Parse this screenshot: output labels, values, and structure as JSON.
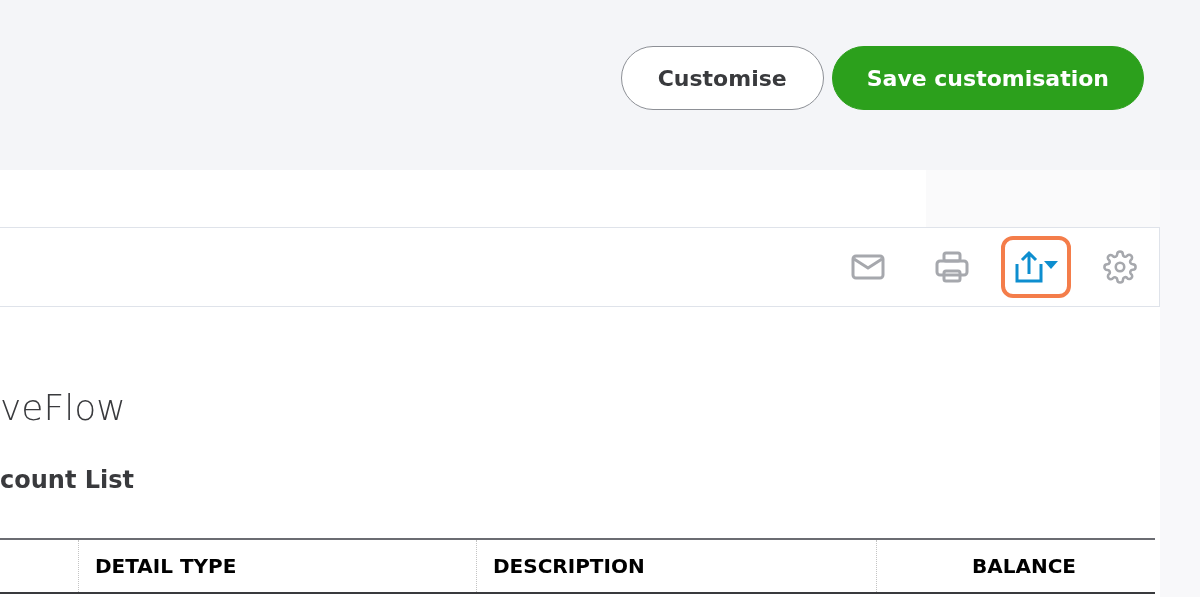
{
  "header": {
    "buttons": [
      {
        "label": "Customise",
        "kind": "secondary"
      },
      {
        "label": "Save customisation",
        "kind": "primary"
      }
    ]
  },
  "report_toolbar": {
    "icons": [
      {
        "kind": "email",
        "highlighted": false
      },
      {
        "kind": "print",
        "highlighted": false
      },
      {
        "kind": "export",
        "highlighted": true
      },
      {
        "kind": "settings",
        "highlighted": false
      }
    ]
  },
  "report": {
    "company": "veFlow",
    "title": "count List",
    "table": {
      "columns": [
        {},
        {
          "label": "DETAIL TYPE"
        },
        {
          "label": "DESCRIPTION"
        },
        {
          "label": "BALANCE"
        }
      ]
    }
  }
}
